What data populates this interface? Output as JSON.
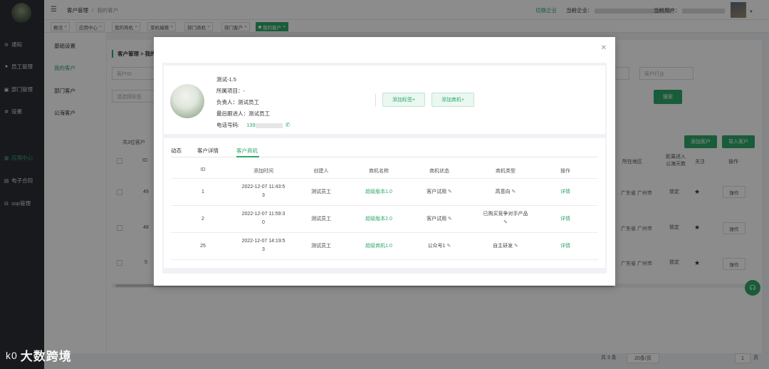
{
  "sidebar": {
    "items": [
      {
        "label": "通知",
        "icon": "message-icon"
      },
      {
        "label": "员工管理",
        "icon": "user-icon"
      },
      {
        "label": "部门管理",
        "icon": "org-icon"
      },
      {
        "label": "设置",
        "icon": "gear-icon"
      },
      {
        "label": "应用中心",
        "icon": "apps-icon"
      },
      {
        "label": "电子合同",
        "icon": "contract-icon"
      },
      {
        "label": "sop管理",
        "icon": "sop-icon"
      }
    ]
  },
  "header": {
    "breadcrumb_root": "客户管理",
    "breadcrumb_sep": "/",
    "breadcrumb_current": "我的客户",
    "switch_enterprise": "切换企业",
    "current_enterprise_label": "当前企业：",
    "current_user_label": "当前用户："
  },
  "tabs": [
    {
      "label": "概况"
    },
    {
      "label": "应用中心"
    },
    {
      "label": "我的商机"
    },
    {
      "label": "菜机编辑"
    },
    {
      "label": "部门商机"
    },
    {
      "label": "部门客户"
    },
    {
      "label": "我的客户"
    }
  ],
  "subnav": {
    "items": [
      "基础设置",
      "我的客户",
      "部门客户",
      "公海客户"
    ]
  },
  "main": {
    "title": "客户管理 > 我的",
    "filters": {
      "customer_id_placeholder": "客户ID",
      "tag_placeholder": "请选择标签",
      "industry_placeholder": "客户行业",
      "search_button": "搜索"
    },
    "total": "共3位客户",
    "buttons": {
      "add_customer": "添加客户",
      "import_customer": "导入客户"
    },
    "columns": {
      "id": "ID",
      "region": "所在地区",
      "distance": "距离进入公海天数",
      "follow": "关注",
      "actions": "操作"
    },
    "rows": [
      {
        "id": "49",
        "region": "广东省 广州市",
        "distance": "锁定",
        "action": "操作"
      },
      {
        "id": "48",
        "region": "广东省 广州市",
        "distance": "锁定",
        "action": "操作"
      },
      {
        "id": "5",
        "region": "广东省 广州市",
        "distance": "锁定",
        "action": "操作"
      }
    ]
  },
  "pagination": {
    "total": "共 3 条",
    "page_size": "20条/页",
    "page": "1",
    "goto": "页"
  },
  "watermark": {
    "logo": "k0",
    "text": "大数跨境"
  },
  "modal": {
    "customer": {
      "name": "测试-1.5",
      "project_label": "所属项目：",
      "project_value": "-",
      "owner_label": "负责人：",
      "owner_value": "测试员工",
      "last_follow_label": "最后跟进人：",
      "last_follow_value": "测试员工",
      "phone_label": "电话号码:",
      "phone_value": "139"
    },
    "add_tag": "添加标签+",
    "add_opportunity": "添加商机+",
    "tabs": [
      "动态",
      "客户详情",
      "客户商机"
    ],
    "table": {
      "headers": [
        "ID",
        "添加时间",
        "创建人",
        "商机名称",
        "商机状态",
        "商机类型",
        "操作"
      ],
      "rows": [
        {
          "id": "1",
          "time_line1": "2022-12-07 11:43:5",
          "time_line2": "3",
          "creator": "测试员工",
          "name": "超级版本1.0",
          "status": "客户试用",
          "type_line1": "高意向",
          "type_line2": "",
          "op": "详情"
        },
        {
          "id": "2",
          "time_line1": "2022-12-07 11:59:3",
          "time_line2": "0",
          "creator": "测试员工",
          "name": "超级版本2.0",
          "status": "客户试用",
          "type_line1": "已购买竞争对手产品",
          "type_line2": "",
          "op": "详情"
        },
        {
          "id": "25",
          "time_line1": "2022-12-07 14:19:5",
          "time_line2": "3",
          "creator": "测试员工",
          "name": "超级商机1.0",
          "status": "公众号1",
          "type_line1": "自主研发",
          "type_line2": "",
          "op": "详情"
        }
      ]
    }
  }
}
